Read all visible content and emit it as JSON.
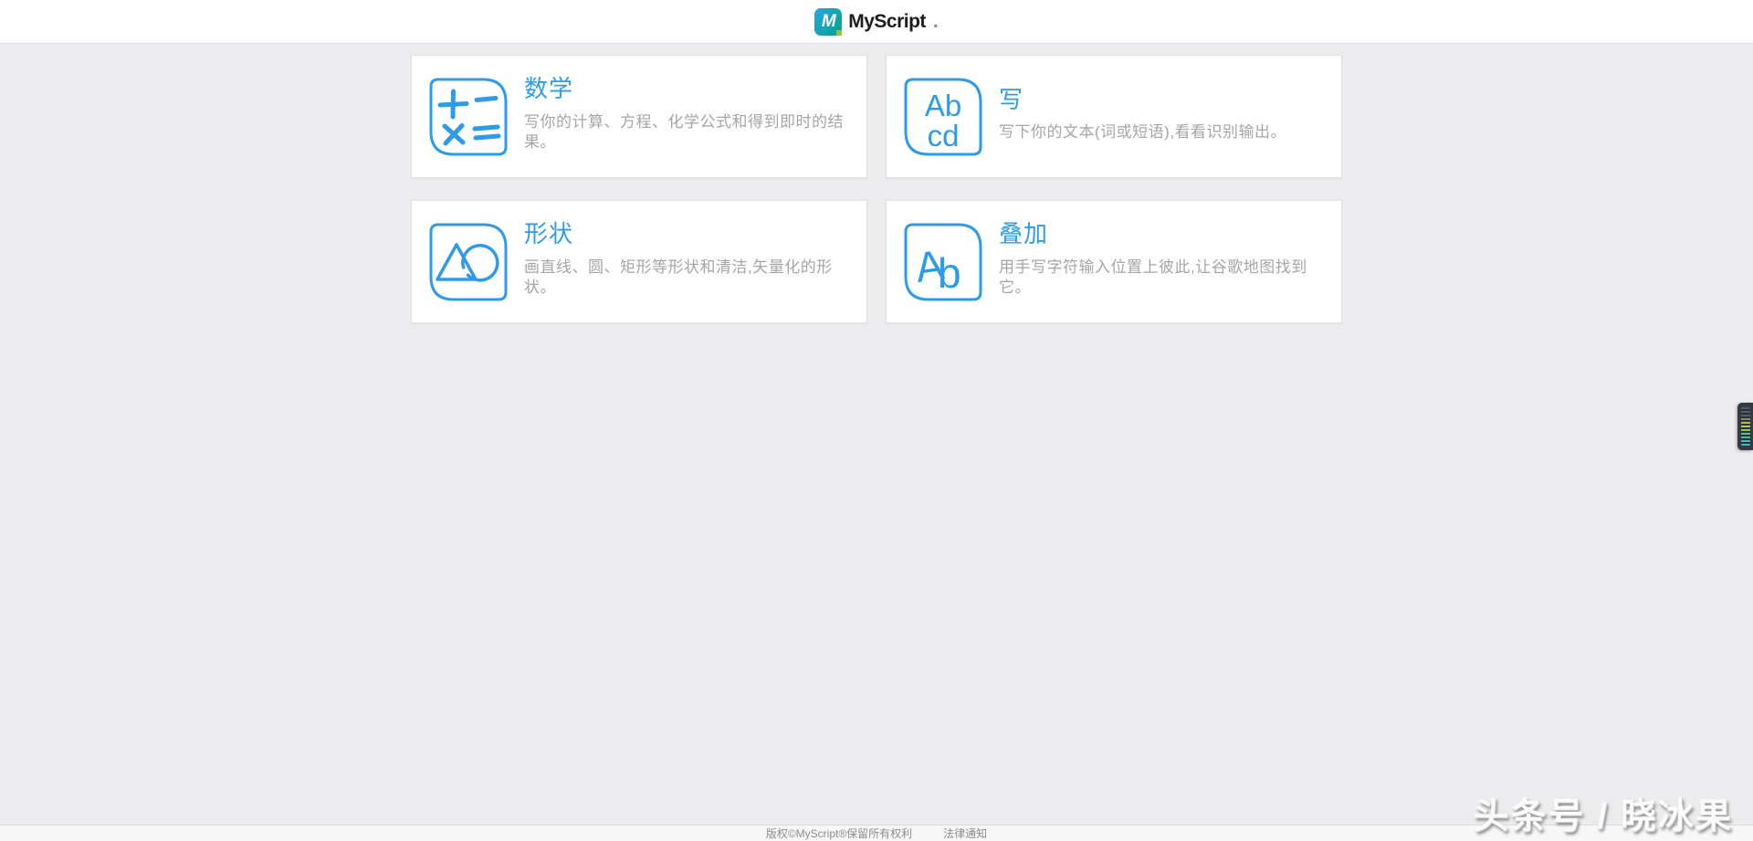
{
  "header": {
    "logo_letter": "M",
    "brand": "MyScript",
    "brand_suffix": "."
  },
  "cards": [
    {
      "title": "数学",
      "description": "写你的计算、方程、化学公式和得到即时的结果。",
      "icon": "math-operators-icon"
    },
    {
      "title": "写",
      "description": "写下你的文本(词或短语),看看识别输出。",
      "icon": "handwritten-letters-icon",
      "icon_text_line1": "Ab",
      "icon_text_line2": "cd"
    },
    {
      "title": "形状",
      "description": "画直线、圆、矩形等形状和清洁,矢量化的形状。",
      "icon": "triangle-circle-shapes-icon"
    },
    {
      "title": "叠加",
      "description": "用手写字符输入位置上彼此,让谷歌地图找到它。",
      "icon": "overlapping-letters-icon",
      "icon_letter_a": "A",
      "icon_letter_b": "b"
    }
  ],
  "footer": {
    "copyright": "版权©MyScript®保留所有权利",
    "legal_link": "法律通知"
  },
  "watermark": "头条号 / 晓冰果",
  "colors": {
    "accent_blue": "#2e9be8",
    "page_background": "#ececee",
    "card_background": "#ffffff",
    "description_gray": "#a5a5a7",
    "logo_gradient_start": "#2aa7e0",
    "logo_gradient_end": "#0b9e8f",
    "logo_dot_green": "#8cc63f"
  }
}
